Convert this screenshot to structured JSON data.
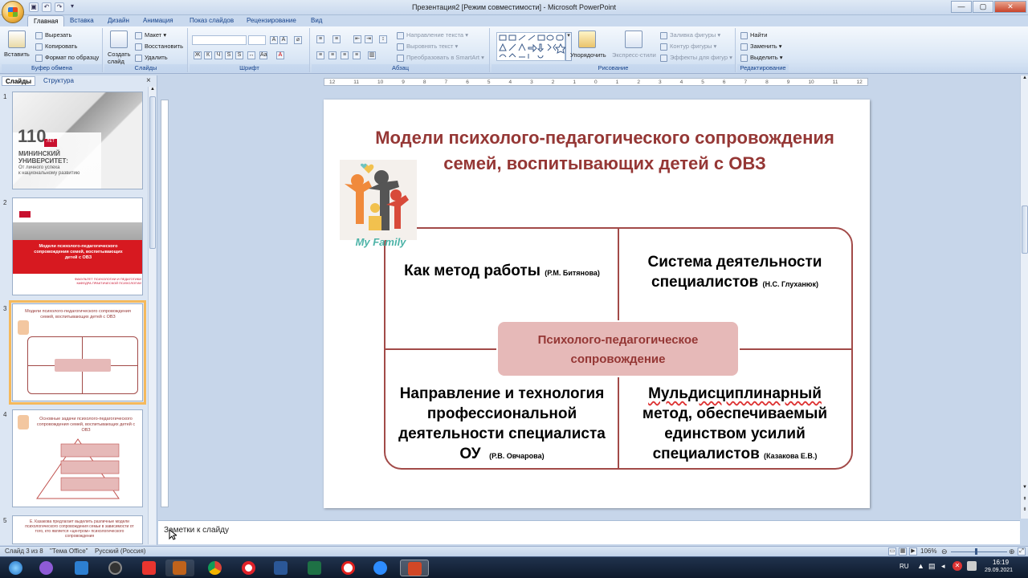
{
  "window": {
    "title": "Презентация2 [Режим совместимости] - Microsoft PowerPoint",
    "controls": {
      "minimize": "—",
      "maximize": "▢",
      "close": "✕"
    }
  },
  "qat": {
    "save_icon": "save-icon",
    "undo": "↶",
    "redo": "↷",
    "more": "▾"
  },
  "tabs": [
    "Главная",
    "Вставка",
    "Дизайн",
    "Анимация",
    "Показ слайдов",
    "Рецензирование",
    "Вид"
  ],
  "ribbon": {
    "clipboard": {
      "label": "Буфер обмена",
      "paste": "Вставить",
      "cut": "Вырезать",
      "copy": "Копировать",
      "format_painter": "Формат по образцу"
    },
    "slides": {
      "label": "Слайды",
      "new_slide": "Создать слайд",
      "layout": "Макет",
      "reset": "Восстановить",
      "delete": "Удалить"
    },
    "font": {
      "label": "Шрифт"
    },
    "paragraph": {
      "label": "Абзац",
      "text_direction": "Направление текста",
      "align_text": "Выровнять текст",
      "smartart": "Преобразовать в SmartArt"
    },
    "drawing": {
      "label": "Рисование",
      "arrange": "Упорядочить",
      "quick_styles": "Экспресс-стили",
      "shape_fill": "Заливка фигуры",
      "shape_outline": "Контур фигуры",
      "shape_effects": "Эффекты для фигур"
    },
    "editing": {
      "label": "Редактирование",
      "find": "Найти",
      "replace": "Заменить",
      "select": "Выделить"
    }
  },
  "left_pane": {
    "tabs": [
      "Слайды",
      "Структура"
    ],
    "close": "×",
    "thumbnails": [
      {
        "num": "1",
        "lines": [
          "110",
          "ЛЕТ",
          "МИНИНСКИЙ",
          "УНИВЕРСИТЕТ:",
          "От личного успеха",
          "к национальному развитию"
        ]
      },
      {
        "num": "2",
        "title": "Модели психолого-педагогического сопровождения семей, воспитывающих детей с ОВЗ",
        "footer": "ФАКУЛЬТЕТ ПСИХОЛОГИИ И ПЕДАГОГИКИ КАФЕДРА ПРАКТИЧЕСКОЙ ПСИХОЛОГИИ"
      },
      {
        "num": "3",
        "title": "Модели психолого-педагогического сопровождения семей, воспитывающих детей с ОВЗ"
      },
      {
        "num": "4",
        "title": "Основные задачи психолого-педагогического сопровождения семей, воспитывающих детей с ОВЗ"
      },
      {
        "num": "5",
        "title": "Е. Казакова предлагает выделить различные модели психологического сопровождения семьи в зависимости от того, кто является «центром» психологического сопровождения"
      }
    ]
  },
  "ruler": {
    "h_ticks": [
      "12",
      "11",
      "10",
      "9",
      "8",
      "7",
      "6",
      "5",
      "4",
      "3",
      "2",
      "1",
      "0",
      "1",
      "2",
      "3",
      "4",
      "5",
      "6",
      "7",
      "8",
      "9",
      "10",
      "11",
      "12"
    ]
  },
  "slide": {
    "title_line1": "Модели психолого-педагогического сопровождения",
    "title_line2": "семей, воспитывающих детей с ОВЗ",
    "logo_text": "My Family",
    "q1_main": "Как метод работы",
    "q1_ref": "(Р.М. Битянова)",
    "q2_line1": "Система деятельности",
    "q2_line2": "специалистов",
    "q2_ref": "(Н.С. Глуханюк)",
    "q3_line1": "Направление и технология",
    "q3_line2": "профессиональной",
    "q3_line3": "деятельности специалиста",
    "q3_line4": "ОУ",
    "q3_ref": "(Р.В. Овчарова)",
    "q4_line1": "Мульдисциплинарный",
    "q4_line2": "метод, обеспечиваемый",
    "q4_line3": "единством усилий",
    "q4_line4": "специалистов",
    "q4_ref": "(Казакова Е.В.)",
    "center_line1": "Психолого-педагогическое",
    "center_line2": "сопровождение",
    "colors": {
      "title": "#953735",
      "frame": "#a24a48",
      "center_fill": "#e6b9b8"
    }
  },
  "notes": {
    "placeholder": "Заметки к слайду"
  },
  "status": {
    "slide_of": "Слайд 3 из 8",
    "theme": "\"Тема Office\"",
    "language": "Русский (Россия)",
    "zoom": "106%"
  },
  "taskbar": {
    "lang": "RU",
    "time": "16:19",
    "date": "29.09.2021"
  }
}
